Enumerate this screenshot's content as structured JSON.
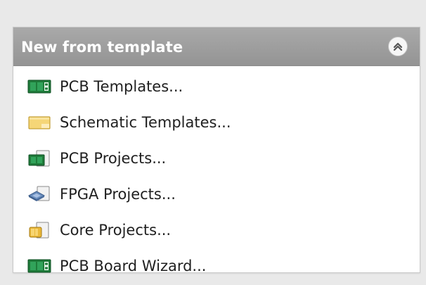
{
  "panel": {
    "title": "New from template",
    "colors": {
      "header": "#9b9b9b",
      "text": "#1f1f1f",
      "panel_bg": "#ffffff",
      "page_bg": "#e9e9e9"
    },
    "items": [
      {
        "label": "PCB Templates...",
        "icon": "pcb-icon"
      },
      {
        "label": "Schematic Templates...",
        "icon": "schematic-icon"
      },
      {
        "label": "PCB Projects...",
        "icon": "pcb-project-icon"
      },
      {
        "label": "FPGA Projects...",
        "icon": "fpga-icon"
      },
      {
        "label": "Core Projects...",
        "icon": "core-project-icon"
      },
      {
        "label": "PCB Board Wizard...",
        "icon": "pcb-wizard-icon"
      }
    ]
  }
}
